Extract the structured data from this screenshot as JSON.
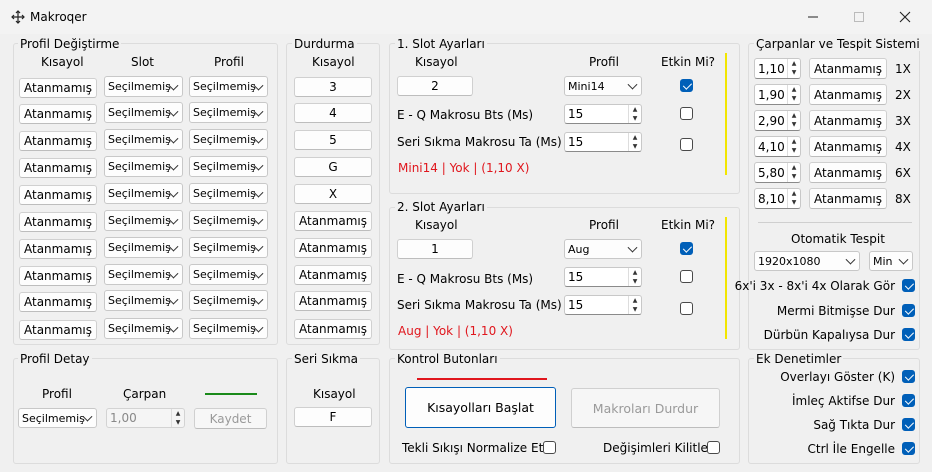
{
  "window": {
    "title": "Makroqer",
    "icon": "move-icon",
    "controls": [
      "minimize",
      "maximize",
      "close"
    ]
  },
  "profil_degistirme": {
    "title": "Profil Değiştirme",
    "headers": [
      "Kısayol",
      "Slot",
      "Profil"
    ],
    "rows": [
      {
        "kisayol": "Atanmamış",
        "slot": "Seçilmemiş",
        "profil": "Seçilmemiş"
      },
      {
        "kisayol": "Atanmamış",
        "slot": "Seçilmemiş",
        "profil": "Seçilmemiş"
      },
      {
        "kisayol": "Atanmamış",
        "slot": "Seçilmemiş",
        "profil": "Seçilmemiş"
      },
      {
        "kisayol": "Atanmamış",
        "slot": "Seçilmemiş",
        "profil": "Seçilmemiş"
      },
      {
        "kisayol": "Atanmamış",
        "slot": "Seçilmemiş",
        "profil": "Seçilmemiş"
      },
      {
        "kisayol": "Atanmamış",
        "slot": "Seçilmemiş",
        "profil": "Seçilmemiş"
      },
      {
        "kisayol": "Atanmamış",
        "slot": "Seçilmemiş",
        "profil": "Seçilmemiş"
      },
      {
        "kisayol": "Atanmamış",
        "slot": "Seçilmemiş",
        "profil": "Seçilmemiş"
      },
      {
        "kisayol": "Atanmamış",
        "slot": "Seçilmemiş",
        "profil": "Seçilmemiş"
      },
      {
        "kisayol": "Atanmamış",
        "slot": "Seçilmemiş",
        "profil": "Seçilmemiş"
      }
    ]
  },
  "durdurma": {
    "title": "Durdurma",
    "header": "Kısayol",
    "keys": [
      "3",
      "4",
      "5",
      "G",
      "X",
      "Atanmamış",
      "Atanmamış",
      "Atanmamış",
      "Atanmamış",
      "Atanmamış"
    ]
  },
  "slot1": {
    "title": "1. Slot Ayarları",
    "h_kisayol": "Kısayol",
    "h_profil": "Profil",
    "h_etkin": "Etkin Mi?",
    "kisayol": "2",
    "profil": "Mini14",
    "eq_label": "E - Q Makrosu Bts (Ms)",
    "eq_value": "15",
    "seri_label": "Seri Sıkma Makrosu Ta (Ms)",
    "seri_value": "15",
    "checks": [
      true,
      false,
      false
    ],
    "status": "Mini14 | Yok | (1,10 X)"
  },
  "slot2": {
    "title": "2. Slot Ayarları",
    "h_kisayol": "Kısayol",
    "h_profil": "Profil",
    "h_etkin": "Etkin Mi?",
    "kisayol": "1",
    "profil": "Aug",
    "eq_label": "E - Q Makrosu Bts (Ms)",
    "eq_value": "15",
    "seri_label": "Seri Sıkma Makrosu Ta (Ms)",
    "seri_value": "15",
    "checks": [
      true,
      false,
      false
    ],
    "status": "Aug | Yok | (1,10 X)"
  },
  "carpanlar": {
    "title": "Çarpanlar ve Tespit Sistemi",
    "rows": [
      {
        "value": "1,10",
        "button": "Atanmamış",
        "mult": "1X"
      },
      {
        "value": "1,90",
        "button": "Atanmamış",
        "mult": "2X"
      },
      {
        "value": "2,90",
        "button": "Atanmamış",
        "mult": "3X"
      },
      {
        "value": "4,10",
        "button": "Atanmamış",
        "mult": "4X"
      },
      {
        "value": "5,80",
        "button": "Atanmamış",
        "mult": "6X"
      },
      {
        "value": "8,10",
        "button": "Atanmamış",
        "mult": "8X"
      }
    ],
    "oto_title": "Otomatik Tespit",
    "resolution": "1920x1080",
    "mode": "Min",
    "options": [
      {
        "label": "6x'i 3x - 8x'i 4x Olarak Gör",
        "checked": true
      },
      {
        "label": "Mermi Bitmişse Dur",
        "checked": true
      },
      {
        "label": "Dürbün Kapalıysa Dur",
        "checked": true
      }
    ]
  },
  "profil_detay": {
    "title": "Profil Detay",
    "h_profil": "Profil",
    "h_carpan": "Çarpan",
    "profil": "Seçilmemiş",
    "carpan": "1,00",
    "save": "Kaydet"
  },
  "seri_sikma": {
    "title": "Seri Sıkma",
    "header": "Kısayol",
    "key": "F"
  },
  "kontrol": {
    "title": "Kontrol Butonları",
    "start": "Kısayolları Başlat",
    "stop": "Makroları Durdur",
    "normalize_label": "Tekli Sıkışı Normalize Et",
    "normalize": false,
    "lock_label": "Değişimleri Kilitle",
    "lock": false
  },
  "ek": {
    "title": "Ek Denetimler",
    "options": [
      {
        "label": "Overlayı Göster (K)",
        "checked": true
      },
      {
        "label": "İmleç Aktifse Dur",
        "checked": true
      },
      {
        "label": "Sağ Tıkta Dur",
        "checked": true
      },
      {
        "label": "Ctrl İle Engelle",
        "checked": true
      }
    ]
  },
  "colors": {
    "accent": "#005fb8",
    "red": "#e0161d",
    "yellow": "#f2e600",
    "green": "#1a8a1a",
    "status_red": "#e0161d"
  }
}
